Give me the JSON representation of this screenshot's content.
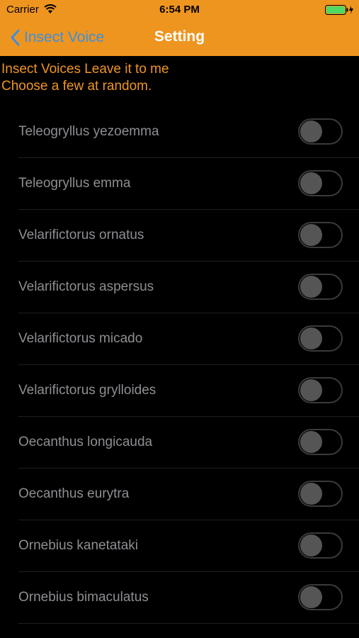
{
  "status_bar": {
    "carrier": "Carrier",
    "time": "6:54 PM"
  },
  "nav": {
    "back_label": "Insect Voice",
    "title": "Setting"
  },
  "intro": {
    "line1": "Insect Voices Leave it to me",
    "line2": "Choose a few at random."
  },
  "species": [
    {
      "label": "Teleogryllus yezoemma",
      "enabled": false
    },
    {
      "label": "Teleogryllus emma",
      "enabled": false
    },
    {
      "label": "Velarifictorus ornatus",
      "enabled": false
    },
    {
      "label": "Velarifictorus aspersus",
      "enabled": false
    },
    {
      "label": "Velarifictorus micado",
      "enabled": false
    },
    {
      "label": "Velarifictorus grylloides",
      "enabled": false
    },
    {
      "label": "Oecanthus longicauda",
      "enabled": false
    },
    {
      "label": "Oecanthus eurytra",
      "enabled": false
    },
    {
      "label": "Ornebius kanetataki",
      "enabled": false
    },
    {
      "label": "Ornebius bimaculatus",
      "enabled": false
    }
  ],
  "colors": {
    "accent": "#EE9520",
    "back_link": "#3B8FE0",
    "background": "#000000",
    "label_text": "#8E8E93"
  }
}
